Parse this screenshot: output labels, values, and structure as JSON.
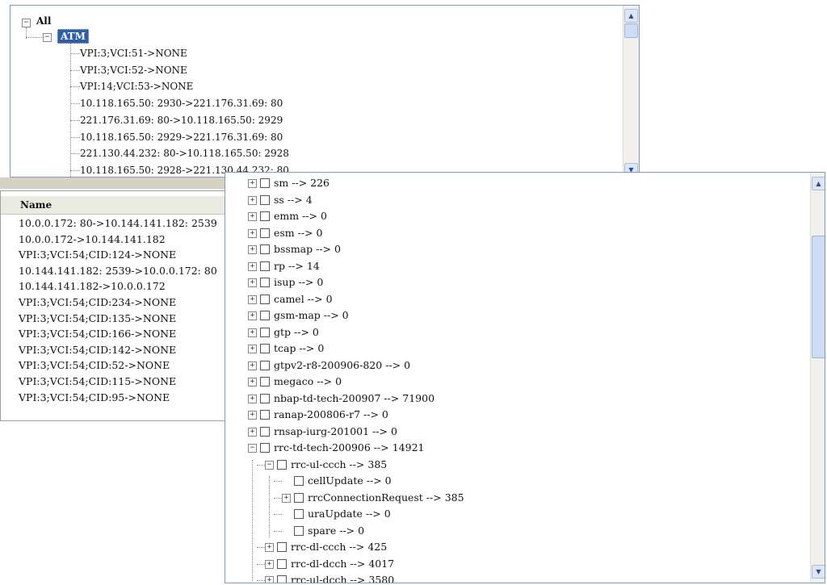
{
  "top_tree": {
    "root": {
      "label": "All",
      "expander": "−"
    },
    "group": {
      "label": "ATM",
      "expander": "−"
    },
    "items": [
      "VPI:3;VCI:51->NONE",
      "VPI:3;VCI:52->NONE",
      "VPI:14;VCI:53->NONE",
      "10.118.165.50: 2930->221.176.31.69: 80",
      "221.176.31.69: 80->10.118.165.50: 2929",
      "10.118.165.50: 2929->221.176.31.69: 80",
      "221.130.44.232: 80->10.118.165.50: 2928",
      "10.118.165.50: 2928->221.130.44.232: 80"
    ]
  },
  "list": {
    "column_header": "Name",
    "rows": [
      "10.0.0.172: 80->10.144.141.182: 2539",
      "10.0.0.172->10.144.141.182",
      "VPI:3;VCI:54;CID:124->NONE",
      "10.144.141.182: 2539->10.0.0.172: 80",
      "10.144.141.182->10.0.0.172",
      "VPI:3;VCI:54;CID:234->NONE",
      "VPI:3;VCI:54;CID:135->NONE",
      "VPI:3;VCI:54;CID:166->NONE",
      "VPI:3;VCI:54;CID:142->NONE",
      "VPI:3;VCI:54;CID:52->NONE",
      "VPI:3;VCI:54;CID:115->NONE",
      "VPI:3;VCI:54;CID:95->NONE"
    ]
  },
  "protocol_tree": {
    "expander_collapsed": "+",
    "expander_expanded": "−",
    "items": [
      {
        "label": "sm --> 226",
        "level": 0,
        "expander": "+"
      },
      {
        "label": "ss --> 4",
        "level": 0,
        "expander": "+"
      },
      {
        "label": "emm --> 0",
        "level": 0,
        "expander": "+"
      },
      {
        "label": "esm --> 0",
        "level": 0,
        "expander": "+"
      },
      {
        "label": "bssmap --> 0",
        "level": 0,
        "expander": "+"
      },
      {
        "label": "rp --> 14",
        "level": 0,
        "expander": "+"
      },
      {
        "label": "isup --> 0",
        "level": 0,
        "expander": "+"
      },
      {
        "label": "camel --> 0",
        "level": 0,
        "expander": "+"
      },
      {
        "label": "gsm-map --> 0",
        "level": 0,
        "expander": "+"
      },
      {
        "label": "gtp --> 0",
        "level": 0,
        "expander": "+"
      },
      {
        "label": "tcap --> 0",
        "level": 0,
        "expander": "+"
      },
      {
        "label": "gtpv2-r8-200906-820 --> 0",
        "level": 0,
        "expander": "+"
      },
      {
        "label": "megaco --> 0",
        "level": 0,
        "expander": "+"
      },
      {
        "label": "nbap-td-tech-200907 --> 71900",
        "level": 0,
        "expander": "+"
      },
      {
        "label": "ranap-200806-r7 --> 0",
        "level": 0,
        "expander": "+"
      },
      {
        "label": "rnsap-iurg-201001 --> 0",
        "level": 0,
        "expander": "+"
      },
      {
        "label": "rrc-td-tech-200906 --> 14921",
        "level": 0,
        "expander": "−"
      },
      {
        "label": "rrc-ul-ccch --> 385",
        "level": 1,
        "expander": "−"
      },
      {
        "label": "cellUpdate --> 0",
        "level": 2,
        "expander": ""
      },
      {
        "label": "rrcConnectionRequest --> 385",
        "level": 2,
        "expander": "+"
      },
      {
        "label": "uraUpdate --> 0",
        "level": 2,
        "expander": ""
      },
      {
        "label": "spare --> 0",
        "level": 2,
        "expander": ""
      },
      {
        "label": "rrc-dl-ccch --> 425",
        "level": 1,
        "expander": "+"
      },
      {
        "label": "rrc-dl-dcch --> 4017",
        "level": 1,
        "expander": "+"
      },
      {
        "label": "rrc-ul-dcch --> 3580",
        "level": 1,
        "expander": "+"
      }
    ]
  },
  "scroll": {
    "up_glyph": "▲",
    "down_glyph": "▼",
    "left_glyph": "◀"
  }
}
